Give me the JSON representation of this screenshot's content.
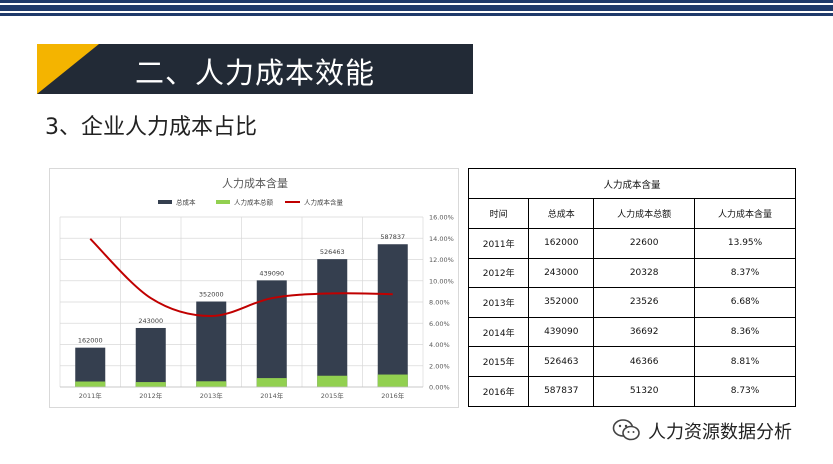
{
  "colors": {
    "banner_bg": "#222a36",
    "banner_accent": "#f4b400",
    "top_stripe_navy": "#1f3a6b",
    "bar_total": "#353f4f",
    "bar_hr": "#92d050",
    "line_ratio": "#c00000"
  },
  "banner": {
    "title": "二、人力成本效能"
  },
  "subtitle": "3、企业人力成本占比",
  "chart_data": {
    "type": "bar",
    "title": "人力成本含量",
    "categories": [
      "2011年",
      "2012年",
      "2013年",
      "2014年",
      "2015年",
      "2016年"
    ],
    "series": [
      {
        "name": "总成本",
        "type": "bar",
        "axis": "left",
        "values": [
          162000,
          243000,
          352000,
          439090,
          526463,
          587837
        ]
      },
      {
        "name": "人力成本总额",
        "type": "bar",
        "axis": "left",
        "values": [
          22600,
          20328,
          23526,
          36692,
          46366,
          51320
        ]
      },
      {
        "name": "人力成本含量",
        "type": "line",
        "axis": "right",
        "values": [
          13.95,
          8.37,
          6.68,
          8.36,
          8.81,
          8.73
        ]
      }
    ],
    "data_labels": [
      "162000",
      "243000",
      "352000",
      "439090",
      "526463",
      "587837"
    ],
    "left_axis": {
      "ylim": [
        0,
        700000
      ],
      "tick_labels_shown": false
    },
    "right_axis": {
      "ylim": [
        0,
        16
      ],
      "ticks": [
        "0.00%",
        "2.00%",
        "4.00%",
        "6.00%",
        "8.00%",
        "10.00%",
        "12.00%",
        "14.00%",
        "16.00%"
      ]
    },
    "legend_position": "top",
    "grid": true
  },
  "table": {
    "title": "人力成本含量",
    "headers": [
      "时间",
      "总成本",
      "人力成本总额",
      "人力成本含量"
    ],
    "rows": [
      [
        "2011年",
        "162000",
        "22600",
        "13.95%"
      ],
      [
        "2012年",
        "243000",
        "20328",
        "8.37%"
      ],
      [
        "2013年",
        "352000",
        "23526",
        "6.68%"
      ],
      [
        "2014年",
        "439090",
        "36692",
        "8.36%"
      ],
      [
        "2015年",
        "526463",
        "46366",
        "8.81%"
      ],
      [
        "2016年",
        "587837",
        "51320",
        "8.73%"
      ]
    ]
  },
  "watermark": {
    "text": "人力资源数据分析",
    "icon": "wechat-icon"
  }
}
